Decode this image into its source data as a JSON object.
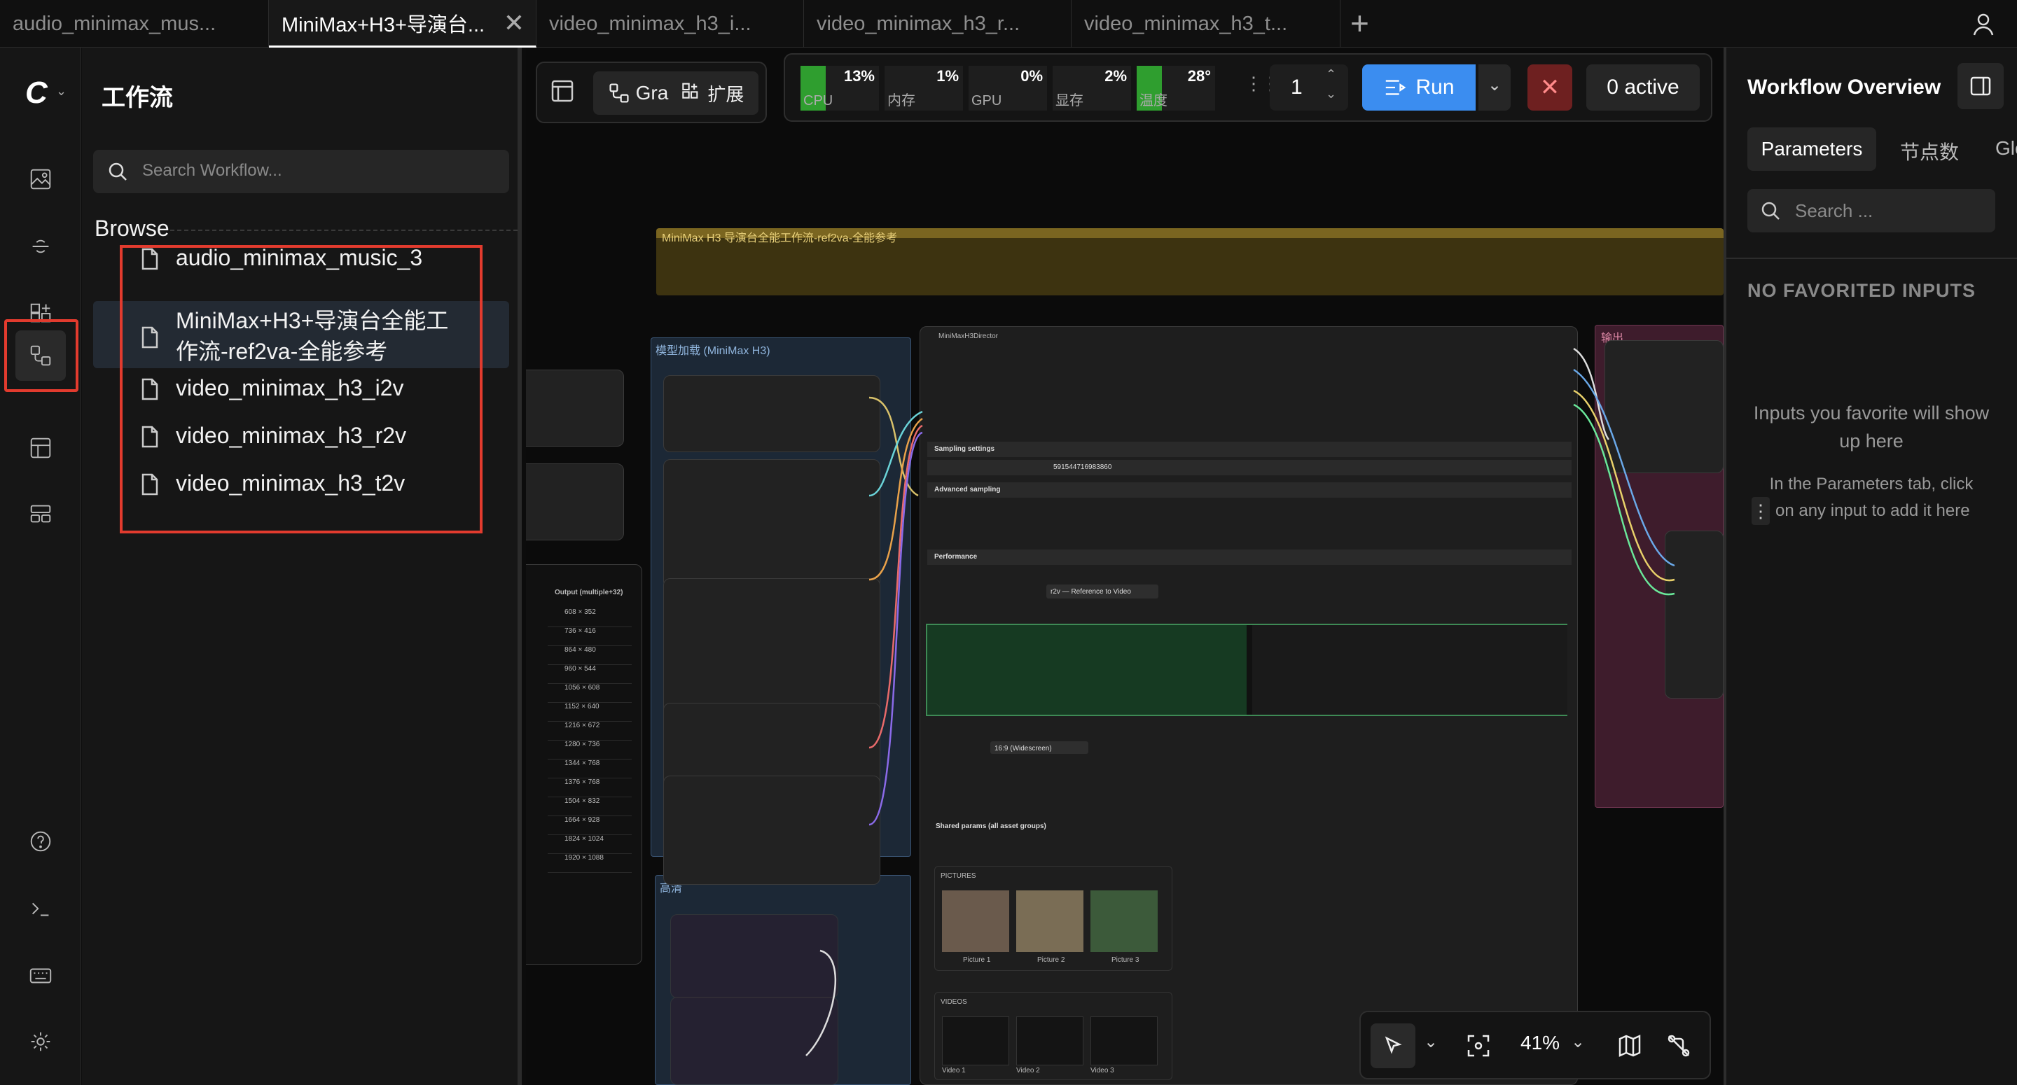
{
  "tabs": [
    {
      "label": "audio_minimax_mus...",
      "active": false
    },
    {
      "label": "MiniMax+H3+导演台...",
      "active": true
    },
    {
      "label": "video_minimax_h3_i...",
      "active": false
    },
    {
      "label": "video_minimax_h3_r...",
      "active": false
    },
    {
      "label": "video_minimax_h3_t...",
      "active": false
    }
  ],
  "tab_close": "✕",
  "new_tab": "+",
  "sidebar": {
    "title": "工作流",
    "search_placeholder": "Search Workflow...",
    "section": "Browse",
    "items": [
      {
        "label": "audio_minimax_music_3"
      },
      {
        "label": "MiniMax+H3+导演台全能工作流-ref2va-全能参考",
        "selected": true
      },
      {
        "label": "video_minimax_h3_i2v"
      },
      {
        "label": "video_minimax_h3_r2v"
      },
      {
        "label": "video_minimax_h3_t2v"
      }
    ]
  },
  "toolbar": {
    "graph_label": "Gra",
    "extend_label": "扩展",
    "stats": [
      {
        "value": "13%",
        "label": "CPU",
        "fill": 0.13
      },
      {
        "value": "1%",
        "label": "内存",
        "fill": 0.01
      },
      {
        "value": "0%",
        "label": "GPU",
        "fill": 0.0
      },
      {
        "value": "2%",
        "label": "显存",
        "fill": 0.02
      },
      {
        "value": "28°",
        "label": "温度",
        "fill": 0.28
      }
    ],
    "queue_count": "1",
    "run_label": "Run",
    "active_label": "0 active"
  },
  "canvas": {
    "top_group_title": "MiniMax H3 导演台全能工作流-ref2va-全能参考",
    "model_group_title": "模型加载 (MiniMax H3)",
    "hd_group_title": "高清",
    "output_group_title": "输出",
    "director_node_title": "MiniMaxH3Director",
    "zoom": "41%",
    "sampling_settings": "Sampling settings",
    "advanced_sampling": "Advanced sampling",
    "performance": "Performance",
    "seed": "591544716983860",
    "resolution": "16:9 (Widescreen)",
    "shared_params": "Shared params (all asset groups)",
    "pictures_label": "PICTURES",
    "videos_label": "VIDEOS",
    "picture_names": [
      "Picture 1",
      "Picture 2",
      "Picture 3"
    ],
    "video_names": [
      "Video 1",
      "Video 2",
      "Video 3"
    ],
    "mode_select": "r2v — Reference to Video",
    "left_node_label": "Output (multiple+32)",
    "res_list": [
      "608 × 352",
      "736 × 416",
      "864 × 480",
      "960 × 544",
      "1056 × 608",
      "1152 × 640",
      "1216 × 672",
      "1280 × 736",
      "1344 × 768",
      "1376 × 768",
      "1504 × 832",
      "1664 × 928",
      "1824 × 1024",
      "1920 × 1088"
    ]
  },
  "right_panel": {
    "title": "Workflow Overview",
    "tabs": [
      "Parameters",
      "节点数",
      "Glo"
    ],
    "search_placeholder": "Search ...",
    "empty_title": "NO FAVORITED INPUTS",
    "empty_line1": "Inputs you favorite will show up here",
    "empty_line2a": "In the Parameters tab, click",
    "empty_line2b": "on any input to add it here"
  },
  "colors": {
    "accent_blue": "#3b8df0",
    "highlight_red": "#e23b2e",
    "stop_red": "#6e2020",
    "group_yellow": "#4a3d10",
    "group_blue": "#1d2b3a",
    "group_magenta": "#4a1f33"
  }
}
